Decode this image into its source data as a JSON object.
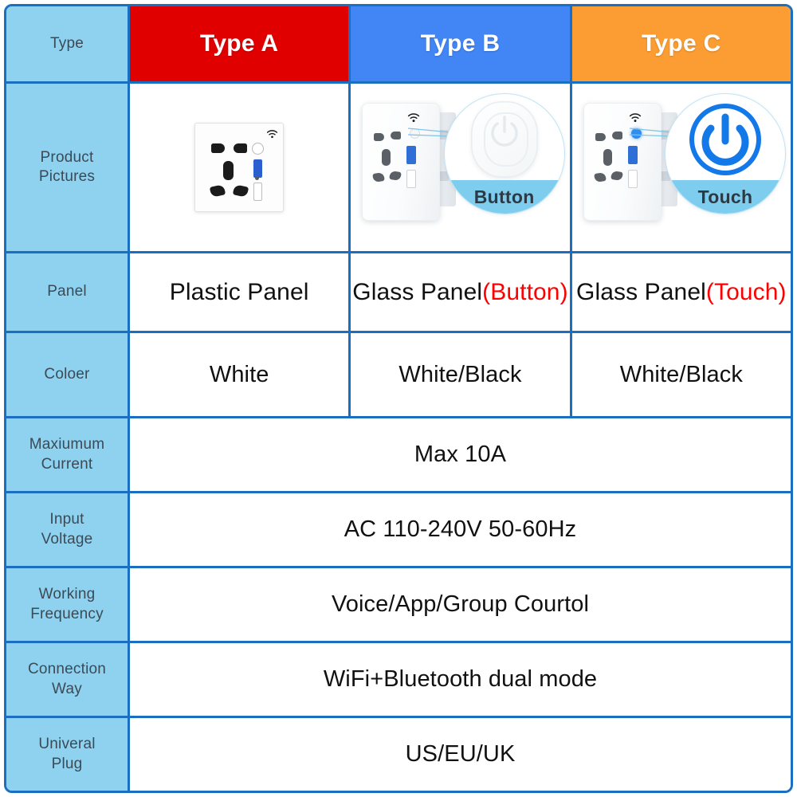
{
  "table": {
    "header": {
      "row_label": "Type",
      "columns": [
        {
          "label": "Type A",
          "color": "#E00000"
        },
        {
          "label": "Type B",
          "color": "#4285F4"
        },
        {
          "label": "Type C",
          "color": "#FB9D32"
        }
      ]
    },
    "rows": [
      {
        "label": "Product\nPictures",
        "label_line1": "Product",
        "label_line2": "Pictures",
        "type": "images",
        "cells": [
          {
            "product": "flat-white-socket",
            "callout": null
          },
          {
            "product": "angled-socket-button",
            "callout": "Button"
          },
          {
            "product": "angled-socket-touch",
            "callout": "Touch"
          }
        ]
      },
      {
        "label": "Panel",
        "type": "text",
        "cells": [
          {
            "text": "Plastic Panel",
            "accent": ""
          },
          {
            "text": "Glass Panel",
            "accent": "(Button)"
          },
          {
            "text": "Glass Panel",
            "accent": "(Touch)"
          }
        ]
      },
      {
        "label": "Coloer",
        "type": "text",
        "cells": [
          {
            "text": "White",
            "accent": ""
          },
          {
            "text": "White/Black",
            "accent": ""
          },
          {
            "text": "White/Black",
            "accent": ""
          }
        ]
      },
      {
        "label_line1": "Maxiumum",
        "label_line2": "Current",
        "type": "merged",
        "value": "Max 10A"
      },
      {
        "label_line1": "Input",
        "label_line2": "Voltage",
        "type": "merged",
        "value": "AC 110-240V 50-60Hz"
      },
      {
        "label_line1": "Working",
        "label_line2": "Frequency",
        "type": "merged",
        "value": "Voice/App/Group Courtol"
      },
      {
        "label_line1": "Connection",
        "label_line2": "Way",
        "type": "merged",
        "value": "WiFi+Bluetooth dual mode"
      },
      {
        "label_line1": "Univeral",
        "label_line2": "Plug",
        "type": "merged",
        "value": "US/EU/UK"
      }
    ]
  },
  "colors": {
    "label_background": "#8ED2F0",
    "border": "#1B6FC0",
    "type_a": "#E00000",
    "type_b": "#4285F4",
    "type_c": "#FB9D32",
    "accent_red": "#FF0000",
    "callout_band": "#7FCDEE",
    "touch_icon": "#1379E8"
  }
}
